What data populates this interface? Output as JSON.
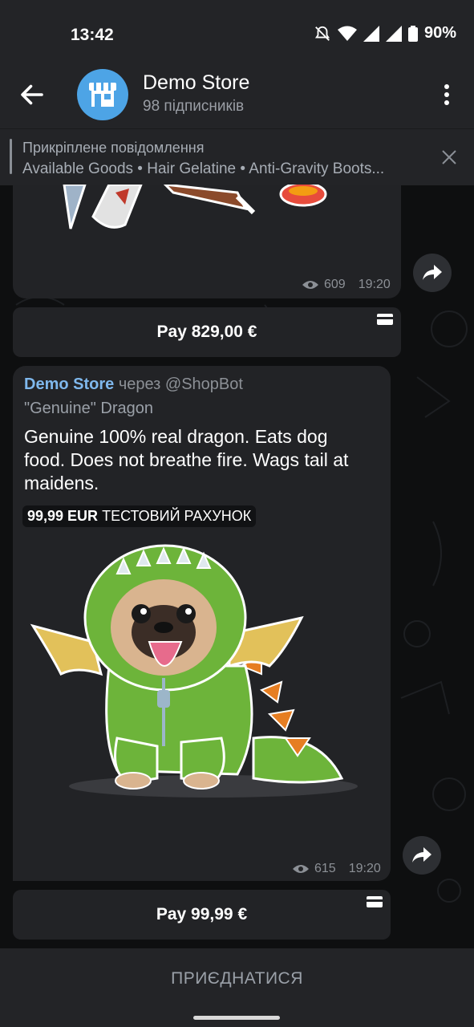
{
  "status": {
    "time": "13:42",
    "battery": "90%"
  },
  "header": {
    "title": "Demo Store",
    "subtitle": "98 підписників"
  },
  "pinned": {
    "title": "Прикріплене повідомлення",
    "text": "Available Goods • Hair Gelatine • Anti-Gravity Boots..."
  },
  "messages": [
    {
      "views": "609",
      "time": "19:20",
      "pay_label": "Pay 829,00 €"
    },
    {
      "sender": "Demo Store",
      "via": "через @ShopBot",
      "title": "\"Genuine\" Dragon",
      "description": "Genuine 100% real dragon. Eats dog food. Does not breathe fire. Wags tail at maidens.",
      "invoice_amount": "99,99 EUR",
      "invoice_label": "ТЕСТОВИЙ РАХУНОК",
      "views": "615",
      "time": "19:20",
      "pay_label": "Pay 99,99 €"
    }
  ],
  "join_label": "ПРИЄДНАТИСЯ",
  "colors": {
    "accent": "#4da4e6",
    "bubble": "#222326",
    "bar": "#232427"
  }
}
